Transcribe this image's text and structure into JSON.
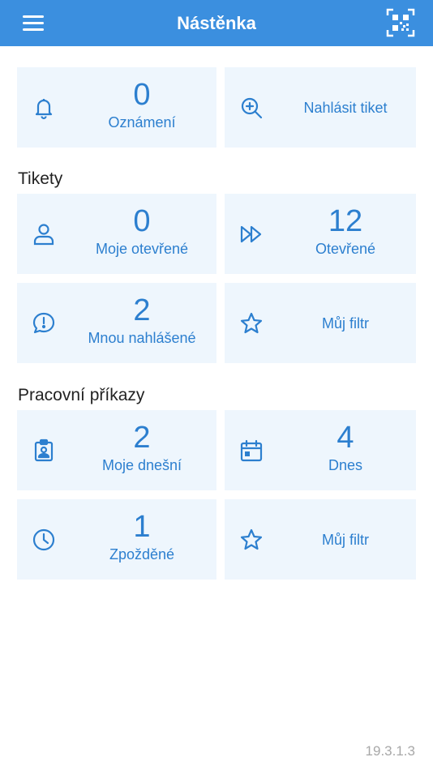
{
  "header": {
    "title": "Nástěnka",
    "menu_icon": "hamburger-icon",
    "qr_icon": "qr-code-icon"
  },
  "top_tiles": [
    {
      "value": "0",
      "label": "Oznámení",
      "icon": "bell-icon"
    },
    {
      "value": "",
      "label": "Nahlásit tiket",
      "icon": "zoom-in-icon"
    }
  ],
  "tickets": {
    "title": "Tikety",
    "tiles": [
      {
        "value": "0",
        "label": "Moje otevřené",
        "icon": "user-icon"
      },
      {
        "value": "12",
        "label": "Otevřené",
        "icon": "fast-forward-icon"
      },
      {
        "value": "2",
        "label": "Mnou nahlášené",
        "icon": "alert-bubble-icon"
      },
      {
        "value": "",
        "label": "Můj filtr",
        "icon": "star-icon"
      }
    ]
  },
  "work_orders": {
    "title": "Pracovní příkazy",
    "tiles": [
      {
        "value": "2",
        "label": "Moje dnešní",
        "icon": "badge-icon"
      },
      {
        "value": "4",
        "label": "Dnes",
        "icon": "calendar-icon"
      },
      {
        "value": "1",
        "label": "Zpožděné",
        "icon": "clock-icon"
      },
      {
        "value": "",
        "label": "Můj filtr",
        "icon": "star-icon"
      }
    ]
  },
  "footer": {
    "version": "19.3.1.3"
  },
  "colors": {
    "accent": "#3b8fdf",
    "tile_bg": "#eef6fd",
    "tile_text": "#2c7fcf"
  }
}
